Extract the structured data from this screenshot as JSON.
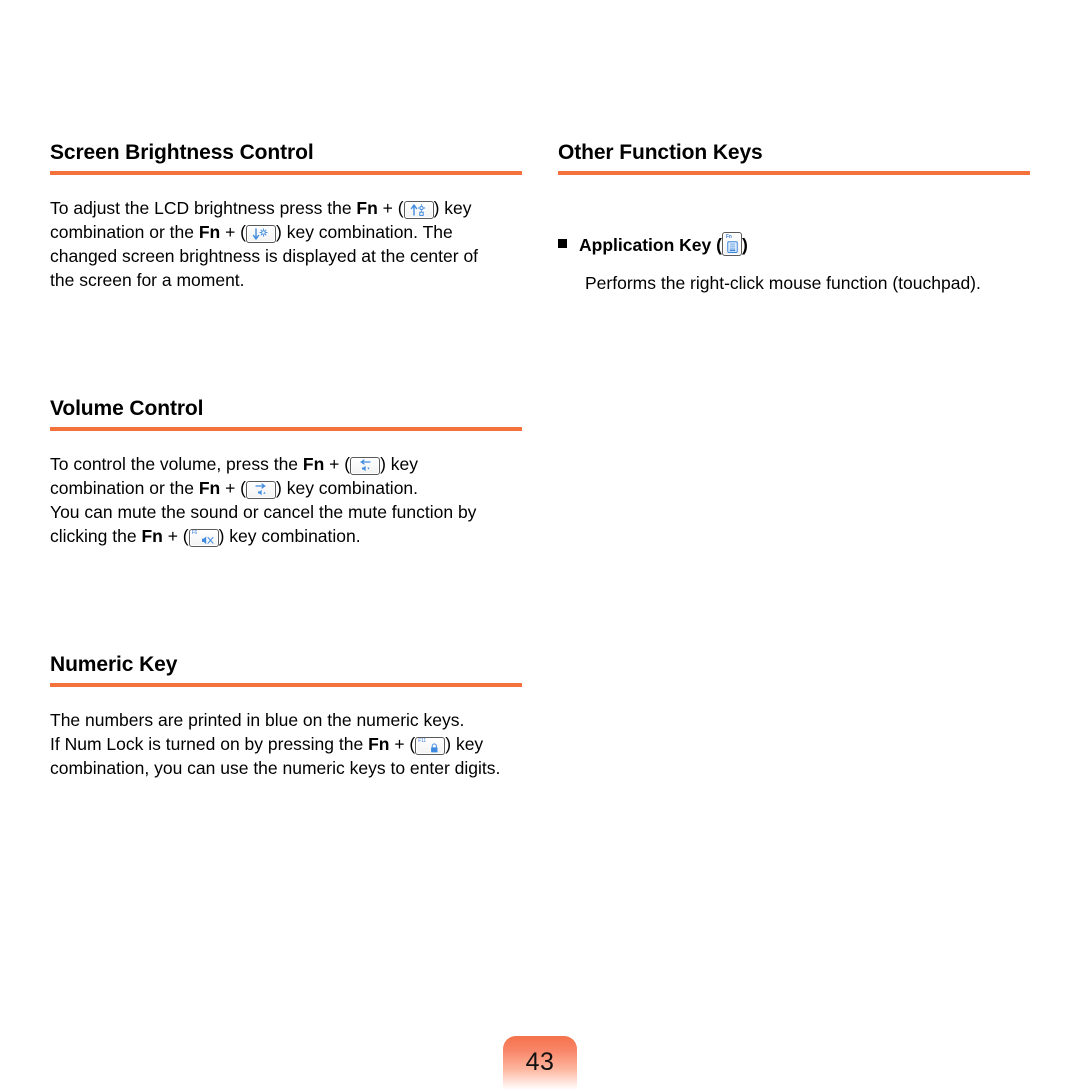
{
  "page": {
    "number": "43",
    "accent_color": "#F4733C",
    "key_glyph_color": "#3E8AE0"
  },
  "left_column": {
    "sections": [
      {
        "id": "screen-brightness-control",
        "title": "Screen Brightness Control",
        "paragraph_runs": [
          {
            "type": "text",
            "text": "To adjust the LCD brightness press the "
          },
          {
            "type": "bold",
            "text": "Fn"
          },
          {
            "type": "text",
            "text": " + ("
          },
          {
            "type": "key",
            "key": "brightness-up-key"
          },
          {
            "type": "text",
            "text": ") key combination or the "
          },
          {
            "type": "bold",
            "text": "Fn"
          },
          {
            "type": "text",
            "text": " + ("
          },
          {
            "type": "key",
            "key": "brightness-down-key"
          },
          {
            "type": "text",
            "text": ") key combination. The changed screen brightness is displayed at the center of the screen for a moment."
          }
        ],
        "plain_text": "To adjust the LCD brightness press the Fn + (  ) key combination or the Fn + (  ) key combination. The changed screen brightness is displayed at the center of the screen for a moment.",
        "text_part_1": "To adjust the LCD brightness press the ",
        "fn_1": "Fn",
        "plus_1": " + (",
        "text_part_2": ") key",
        "text_part_3": "combination or the ",
        "fn_2": "Fn",
        "plus_2": " + (",
        "text_part_4": ") key combination. The",
        "text_part_5": "changed screen brightness is displayed at the center of",
        "text_part_6": "the screen for a moment."
      },
      {
        "id": "volume-control",
        "title": "Volume Control",
        "text_part_1": "To control the volume, press the ",
        "fn_1": "Fn",
        "plus_1": " + (",
        "text_part_2": ") key",
        "text_part_3": "combination or the ",
        "fn_2": "Fn",
        "plus_2": " + (",
        "text_part_4": ") key combination.",
        "text_part_5": "You can mute the sound or cancel the mute function by",
        "text_part_6": "clicking the ",
        "fn_3": "Fn",
        "plus_3": " + (",
        "text_part_7": ") key combination."
      },
      {
        "id": "numeric-key",
        "title": "Numeric Key",
        "text_part_1": "The numbers are printed in blue on the numeric keys.",
        "text_part_2": "If Num Lock is turned on by pressing the ",
        "fn_1": "Fn",
        "plus_1": " + (",
        "text_part_3": ") key",
        "text_part_4": "combination, you can use the numeric keys to enter digits."
      }
    ]
  },
  "right_column": {
    "sections": [
      {
        "id": "other-function-keys",
        "title": "Other Function Keys",
        "items": [
          {
            "label": "Application Key",
            "open_paren": "(",
            "close_paren": ")",
            "description": "Performs the right-click mouse function (touchpad)."
          }
        ]
      }
    ]
  },
  "keycaps": {
    "brightness_up": {
      "name": "brightness-up-key",
      "glyph": "↑",
      "symbol": "sun"
    },
    "brightness_down": {
      "name": "brightness-down-key",
      "glyph": "↓",
      "symbol": "sun"
    },
    "volume_down": {
      "name": "volume-down-key",
      "glyph": "speaker",
      "symbol": "arrow-left"
    },
    "volume_up": {
      "name": "volume-up-key",
      "glyph": "speaker",
      "symbol": "arrow-right"
    },
    "mute": {
      "name": "mute-key",
      "f_label": "F6",
      "glyph": "speaker-mute"
    },
    "num_lock": {
      "name": "num-lock-key",
      "f_label": "F11",
      "glyph": "lock"
    },
    "application": {
      "name": "application-key",
      "f_label": "Fn",
      "glyph": "menu"
    }
  }
}
